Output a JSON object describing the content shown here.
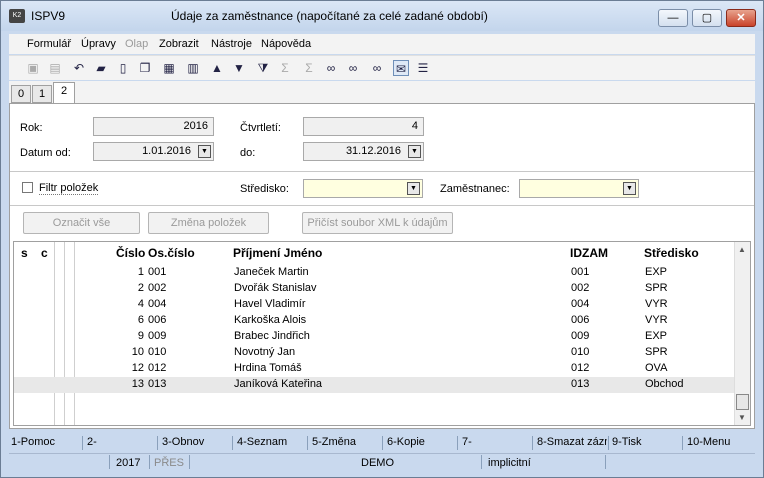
{
  "window": {
    "app_name": "ISPV9",
    "title": "Údaje za zaměstnance (napočítané za celé zadané období)",
    "minimize": "—",
    "maximize": "▢",
    "close": "✕"
  },
  "menu": [
    "Formulář",
    "Úpravy",
    "Olap",
    "Zobrazit",
    "Nástroje",
    "Nápověda"
  ],
  "toolbar_icons": [
    "save-icon",
    "save-all-icon",
    "undo-icon",
    "open-folder-icon",
    "new-document-icon",
    "copy-icon",
    "lock-icon",
    "book-icon",
    "arrow-up-icon",
    "arrow-down-icon",
    "filter-icon",
    "sum-icon",
    "sum-filter-icon",
    "binoculars-icon",
    "binoculars-next-icon",
    "binoculars-settings-icon",
    "envelope-icon",
    "list-icon"
  ],
  "tabs": [
    "0",
    "1",
    "2"
  ],
  "form": {
    "rok_label": "Rok:",
    "rok_value": "2016",
    "ctvrtleti_label": "Čtvrtletí:",
    "ctvrtleti_value": "4",
    "datum_od_label": "Datum od:",
    "datum_od_value": "1.01.2016",
    "do_label": "do:",
    "do_value": "31.12.2016",
    "filtr_label": "Filtr položek",
    "stredisko_label": "Středisko:",
    "stredisko_value": "",
    "zamestnanec_label": "Zaměstnanec:",
    "zamestnanec_value": ""
  },
  "buttons": {
    "oznacit_vse": "Označit vše",
    "zmena_polozek": "Změna položek",
    "pricist_xml": "Přičíst soubor XML k údajům"
  },
  "table": {
    "headers": [
      "s",
      "c",
      "Číslo",
      "Os.číslo",
      "Příjmení Jméno",
      "IDZAM",
      "Středisko"
    ],
    "rows": [
      [
        "1",
        "001",
        "Janeček Martin",
        "001",
        "EXP"
      ],
      [
        "2",
        "002",
        "Dvořák Stanislav",
        "002",
        "SPR"
      ],
      [
        "4",
        "004",
        "Havel Vladimír",
        "004",
        "VYR"
      ],
      [
        "6",
        "006",
        "Karkoška Alois",
        "006",
        "VYR"
      ],
      [
        "9",
        "009",
        "Brabec Jindřich",
        "009",
        "EXP"
      ],
      [
        "10",
        "010",
        "Novotný Jan",
        "010",
        "SPR"
      ],
      [
        "12",
        "012",
        "Hrdina Tomáš",
        "012",
        "OVA"
      ],
      [
        "13",
        "013",
        "Janíková Kateřina",
        "013",
        "Obchod"
      ]
    ]
  },
  "fkeys": [
    "1-Pomoc",
    "2-",
    "3-Obnov",
    "4-Seznam",
    "5-Změna",
    "6-Kopie",
    "7-",
    "8-Smazat zázn",
    "9-Tisk",
    "10-Menu"
  ],
  "status": {
    "year": "2017",
    "mode": "PŘES",
    "db": "DEMO",
    "profile": "implicitní"
  }
}
